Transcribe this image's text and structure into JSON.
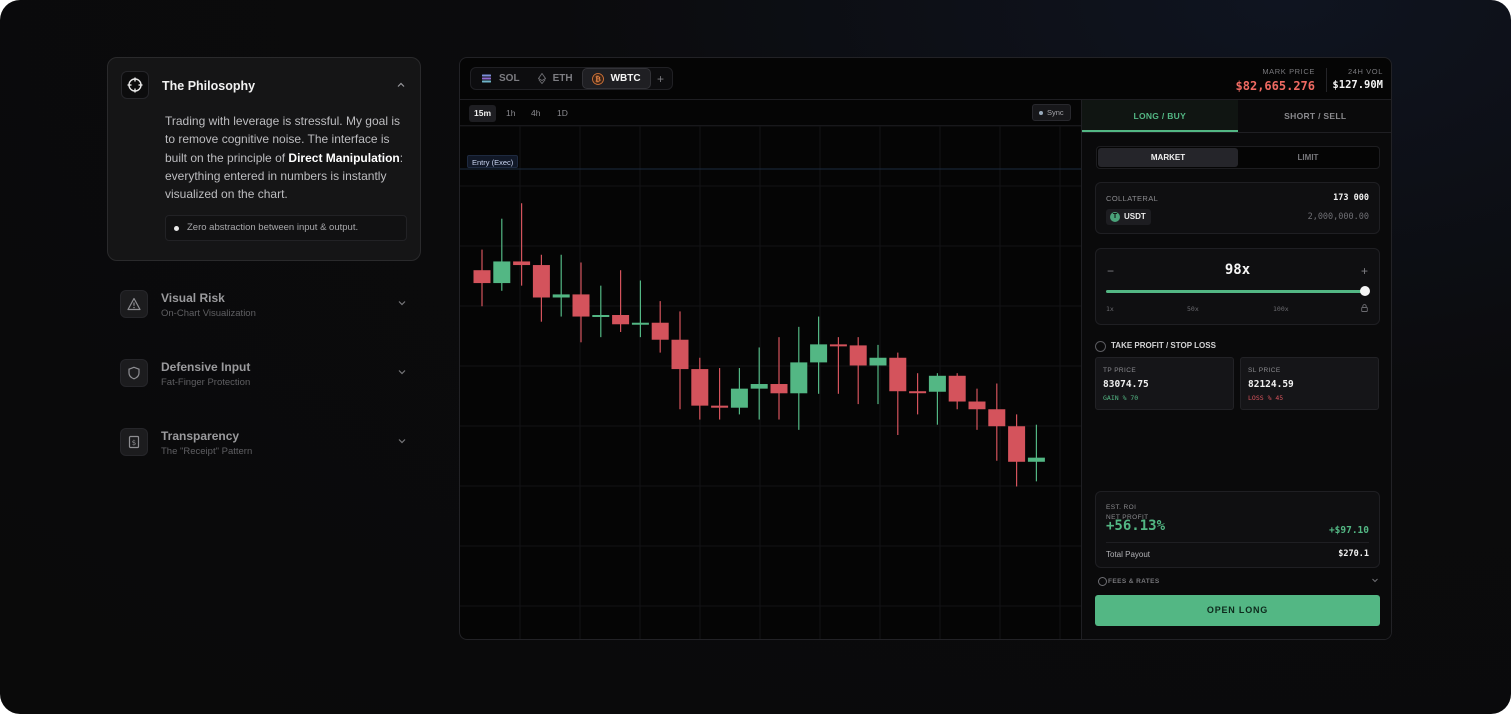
{
  "colors": {
    "up": "#53b784",
    "down": "#d4535c",
    "accent_red": "#ef6a62",
    "accent_green": "#53b784"
  },
  "accordion": [
    {
      "title": "The Philosophy",
      "icon": "crosshair-icon",
      "expanded": true,
      "body_parts": {
        "a": "Trading with leverage is stressful. My goal is to remove cognitive noise. The interface is built on the principle of ",
        "bold": "Direct Manipulation",
        "b": ": everything entered in numbers is instantly visualized on the chart."
      },
      "note": "Zero abstraction between input & output."
    },
    {
      "title": "Visual Risk",
      "subtitle": "On-Chart Visualization",
      "icon": "warning-icon"
    },
    {
      "title": "Defensive Input",
      "subtitle": "Fat-Finger Protection",
      "icon": "shield-icon"
    },
    {
      "title": "Transparency",
      "subtitle": "The \"Receipt\" Pattern",
      "icon": "receipt-icon"
    }
  ],
  "asset_tabs": [
    {
      "label": "SOL",
      "icon": "solana-icon",
      "active": false
    },
    {
      "label": "ETH",
      "icon": "ethereum-icon",
      "active": false
    },
    {
      "label": "WBTC",
      "icon": "bitcoin-icon",
      "active": true
    }
  ],
  "add_tab": "+",
  "stats": {
    "mark_price_label": "MARK PRICE",
    "mark_price": "$82,665.276",
    "vol_label": "24H VOL",
    "vol": "$127.90M"
  },
  "timeframes": [
    {
      "label": "15m",
      "active": true
    },
    {
      "label": "1h",
      "active": false
    },
    {
      "label": "4h",
      "active": false
    },
    {
      "label": "1D",
      "active": false
    }
  ],
  "sync_label": "Sync",
  "entry_label": "Entry (Exec)",
  "candles": [
    {
      "o": 0.72,
      "c": 0.695,
      "h": 0.76,
      "l": 0.65
    },
    {
      "o": 0.695,
      "c": 0.737,
      "h": 0.82,
      "l": 0.68
    },
    {
      "o": 0.737,
      "c": 0.73,
      "h": 0.85,
      "l": 0.69
    },
    {
      "o": 0.73,
      "c": 0.667,
      "h": 0.75,
      "l": 0.62
    },
    {
      "o": 0.667,
      "c": 0.673,
      "h": 0.75,
      "l": 0.63
    },
    {
      "o": 0.673,
      "c": 0.63,
      "h": 0.735,
      "l": 0.58
    },
    {
      "o": 0.63,
      "c": 0.633,
      "h": 0.69,
      "l": 0.59
    },
    {
      "o": 0.633,
      "c": 0.615,
      "h": 0.72,
      "l": 0.6
    },
    {
      "o": 0.615,
      "c": 0.618,
      "h": 0.7,
      "l": 0.59
    },
    {
      "o": 0.618,
      "c": 0.585,
      "h": 0.66,
      "l": 0.56
    },
    {
      "o": 0.585,
      "c": 0.528,
      "h": 0.64,
      "l": 0.45
    },
    {
      "o": 0.528,
      "c": 0.457,
      "h": 0.55,
      "l": 0.43
    },
    {
      "o": 0.457,
      "c": 0.453,
      "h": 0.53,
      "l": 0.43
    },
    {
      "o": 0.453,
      "c": 0.49,
      "h": 0.53,
      "l": 0.44
    },
    {
      "o": 0.49,
      "c": 0.499,
      "h": 0.57,
      "l": 0.43
    },
    {
      "o": 0.499,
      "c": 0.481,
      "h": 0.59,
      "l": 0.43
    },
    {
      "o": 0.481,
      "c": 0.541,
      "h": 0.61,
      "l": 0.41
    },
    {
      "o": 0.541,
      "c": 0.576,
      "h": 0.63,
      "l": 0.48
    },
    {
      "o": 0.576,
      "c": 0.574,
      "h": 0.59,
      "l": 0.48
    },
    {
      "o": 0.574,
      "c": 0.535,
      "h": 0.59,
      "l": 0.46
    },
    {
      "o": 0.535,
      "c": 0.55,
      "h": 0.575,
      "l": 0.46
    },
    {
      "o": 0.55,
      "c": 0.485,
      "h": 0.56,
      "l": 0.4
    },
    {
      "o": 0.485,
      "c": 0.484,
      "h": 0.52,
      "l": 0.44
    },
    {
      "o": 0.484,
      "c": 0.515,
      "h": 0.52,
      "l": 0.42
    },
    {
      "o": 0.515,
      "c": 0.465,
      "h": 0.52,
      "l": 0.45
    },
    {
      "o": 0.465,
      "c": 0.45,
      "h": 0.49,
      "l": 0.41
    },
    {
      "o": 0.45,
      "c": 0.417,
      "h": 0.5,
      "l": 0.35
    },
    {
      "o": 0.417,
      "c": 0.348,
      "h": 0.44,
      "l": 0.3
    },
    {
      "o": 0.348,
      "c": 0.356,
      "h": 0.42,
      "l": 0.31
    }
  ],
  "order": {
    "side_tabs": [
      "LONG / BUY",
      "SHORT / SELL"
    ],
    "type_tabs": [
      "MARKET",
      "LIMIT"
    ],
    "collateral_label": "COLLATERAL",
    "collateral_value": "173 000",
    "collateral_token": "USDT",
    "collateral_balance": "2,000,000.00",
    "leverage_minus": "−",
    "leverage_plus": "+",
    "leverage": "98x",
    "leverage_fraction": 0.98,
    "leverage_ticks": [
      "1x",
      "50x",
      "100x"
    ],
    "tpsl_label": "TAKE PROFIT / STOP LOSS",
    "tp_label": "TP PRICE",
    "tp_value": "83074.75",
    "tp_sub": "GAIN % 70",
    "sl_label": "SL PRICE",
    "sl_value": "82124.59",
    "sl_sub": "LOSS % 45",
    "roi_label": "EST. ROI",
    "roi_value": "+56.13%",
    "net_profit_label": "NET PROFIT",
    "net_profit": "+$97.10",
    "total_payout_label": "Total Payout",
    "total_payout": "$270.1",
    "fees_label": "FEES & RATES",
    "submit_label": "OPEN LONG"
  }
}
